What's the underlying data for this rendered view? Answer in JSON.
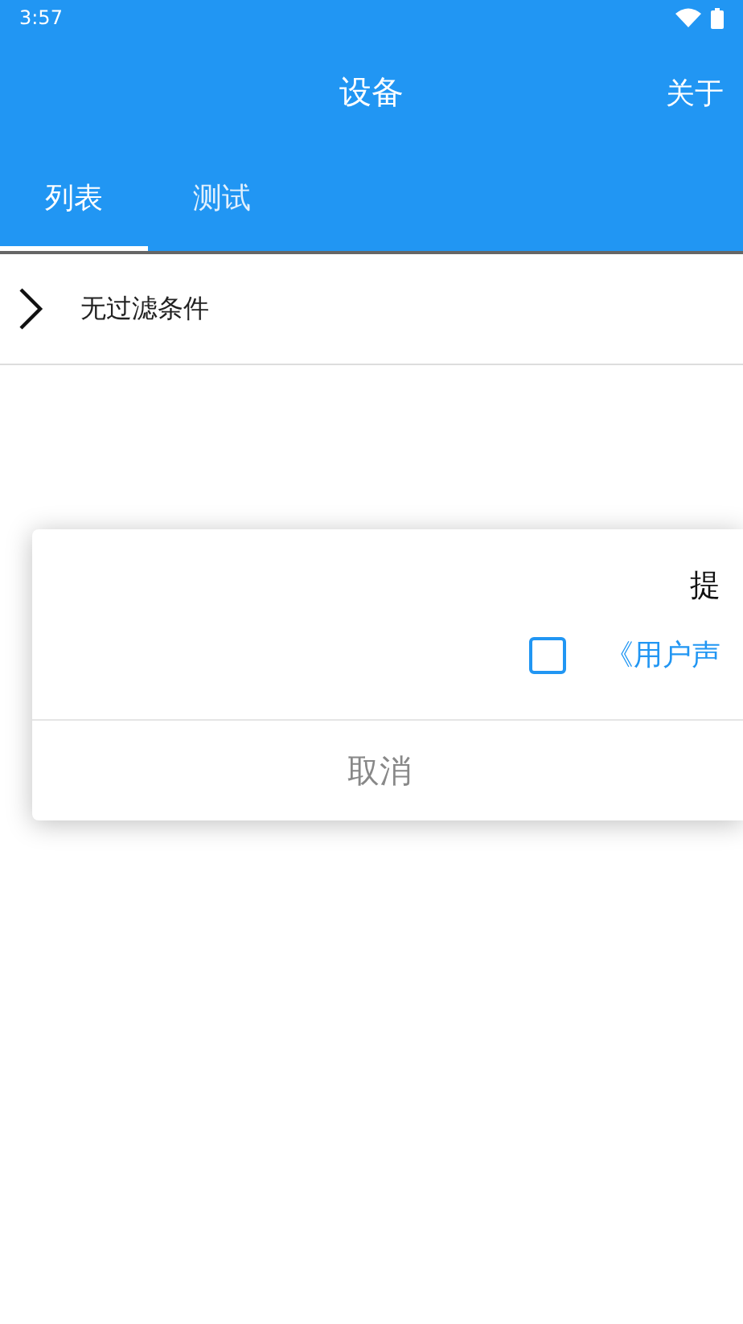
{
  "status_bar": {
    "time": "3:57"
  },
  "app_bar": {
    "title": "设备",
    "action": "关于"
  },
  "tabs": [
    {
      "label": "列表",
      "selected": true
    },
    {
      "label": "测试",
      "selected": false
    }
  ],
  "filter": {
    "label": "无过滤条件"
  },
  "dialog": {
    "title": "提",
    "agree": {
      "checked": false,
      "link": "《用户声"
    },
    "cancel": "取消"
  }
}
